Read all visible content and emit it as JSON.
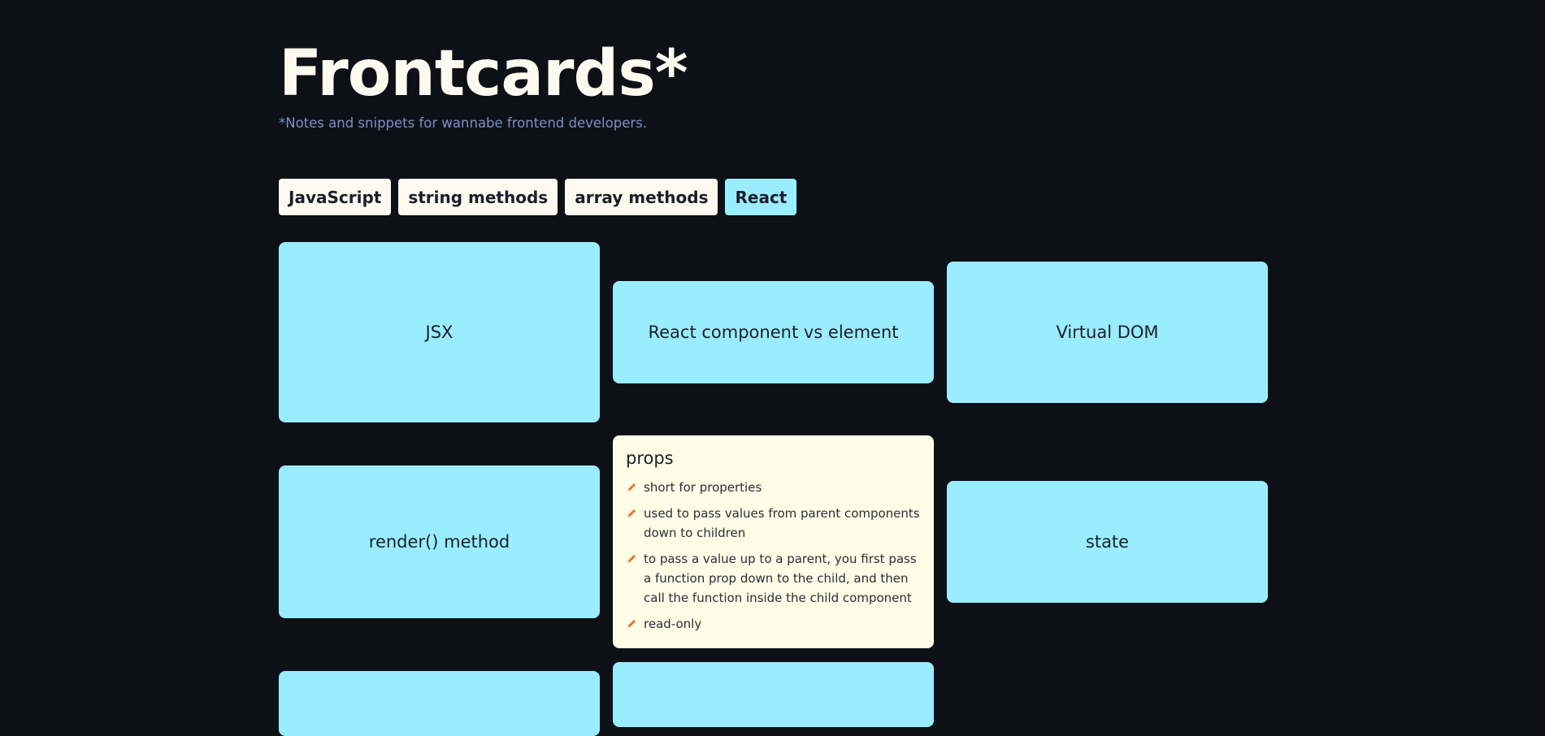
{
  "header": {
    "title": "Frontcards*",
    "subtitle": "*Notes and snippets for wannabe frontend developers."
  },
  "tabs": [
    {
      "label": "JavaScript",
      "active": false
    },
    {
      "label": "string methods",
      "active": false
    },
    {
      "label": "array methods",
      "active": false
    },
    {
      "label": "React",
      "active": true
    }
  ],
  "cards": {
    "jsx": {
      "title": "JSX"
    },
    "component_vs_element": {
      "title": "React component vs element"
    },
    "virtual_dom": {
      "title": "Virtual DOM"
    },
    "render_method": {
      "title": "render() method"
    },
    "props": {
      "title": "props",
      "notes": [
        "short for properties",
        "used to pass values from parent components down to children",
        "to pass a value up to a parent, you first pass a function prop down to the child, and then call the function inside the child component",
        "read-only"
      ]
    },
    "state": {
      "title": "state"
    }
  },
  "colors": {
    "background": "#0d1117",
    "card": "#9aedfe",
    "open_card": "#fefde6",
    "accent": "#f26b21",
    "subtitle": "#7b8fc7"
  },
  "icons": {
    "note_bullet": "pencil-icon"
  }
}
